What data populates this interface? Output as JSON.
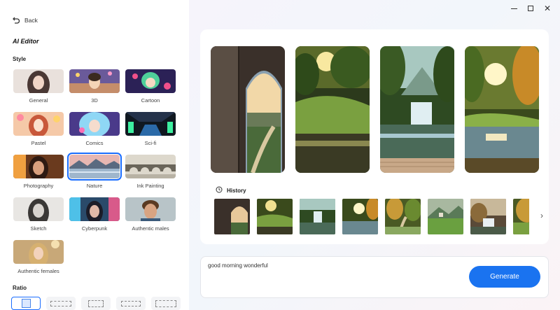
{
  "window": {
    "minimize_icon": "minimize-icon",
    "maximize_icon": "maximize-icon",
    "close_icon": "close-icon"
  },
  "sidebar": {
    "back_label": "Back",
    "title": "AI Editor",
    "style_heading": "Style",
    "styles": [
      {
        "label": "General"
      },
      {
        "label": "3D"
      },
      {
        "label": "Cartoon"
      },
      {
        "label": "Pastel"
      },
      {
        "label": "Comics"
      },
      {
        "label": "Sci-fi"
      },
      {
        "label": "Photography"
      },
      {
        "label": "Nature",
        "selected": true
      },
      {
        "label": "Ink Painting"
      },
      {
        "label": "Sketch"
      },
      {
        "label": "Cyberpunk"
      },
      {
        "label": "Authentic males"
      },
      {
        "label": "Authentic females"
      }
    ],
    "ratio_heading": "Ratio",
    "selected_ratio_index": 0
  },
  "main": {
    "history_heading": "History",
    "prompt_value": "good morning wonderful",
    "generate_label": "Generate"
  },
  "colors": {
    "accent": "#1a73f0",
    "selection": "#1a6dff"
  }
}
